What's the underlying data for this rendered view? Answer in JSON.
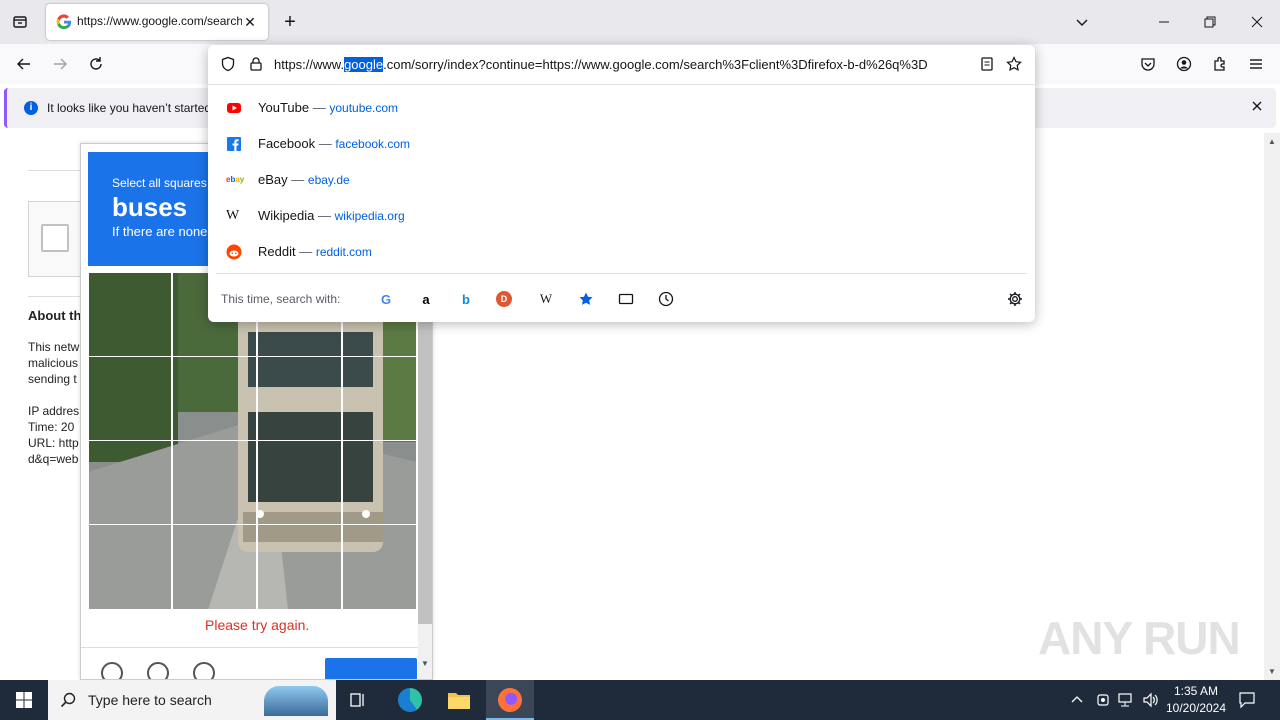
{
  "browser": {
    "tab_title": "https://www.google.com/search",
    "tab_close": "✕",
    "new_tab": "+",
    "url_prefix": "https://www.",
    "url_highlight": "google",
    "url_suffix": ".com/sorry/index?continue=https://www.google.com/search%3Fclient%3Dfirefox-b-d%26q%3D"
  },
  "notification": {
    "text": "It looks like you haven’t started"
  },
  "page": {
    "about": "About th",
    "line1": "This netw",
    "line2": "malicious",
    "line3": "sending t",
    "ip": "IP addres",
    "time": "Time: 20",
    "url": "URL: http",
    "q": "d&q=web"
  },
  "captcha": {
    "instruction": "Select all squares",
    "target": "buses",
    "hint": "If there are none",
    "error": "Please try again."
  },
  "suggestions": [
    {
      "name": "YouTube",
      "sep": "—",
      "url": "youtube.com"
    },
    {
      "name": "Facebook",
      "sep": "—",
      "url": "facebook.com"
    },
    {
      "name": "eBay",
      "sep": "—",
      "url": "ebay.de"
    },
    {
      "name": "Wikipedia",
      "sep": "—",
      "url": "wikipedia.org"
    },
    {
      "name": "Reddit",
      "sep": "—",
      "url": "reddit.com"
    }
  ],
  "search_with": {
    "label": "This time, search with:",
    "engines": [
      "G",
      "a",
      "b",
      "D",
      "W"
    ]
  },
  "taskbar": {
    "search_placeholder": "Type here to search",
    "time": "1:35 AM",
    "date": "10/20/2024"
  },
  "watermark": "ANY RUN",
  "colors": {
    "accent": "#1a73e8",
    "error": "#d93025",
    "link": "#0061e0",
    "taskbar": "#1f2b3a"
  }
}
